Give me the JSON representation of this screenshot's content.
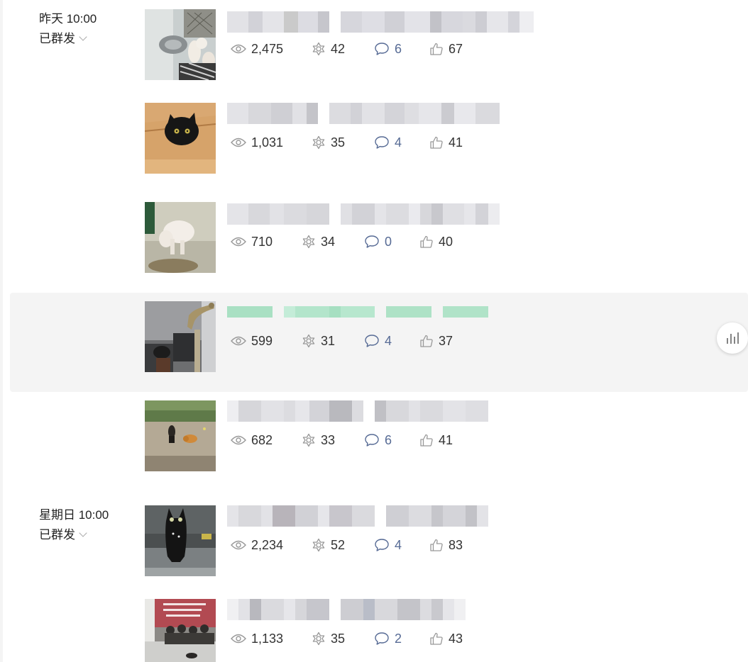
{
  "groups": [
    {
      "date": "昨天 10:00",
      "status": "已群发",
      "articles": [
        {
          "views": "2,475",
          "shares": "42",
          "comments": "6",
          "likes": "67"
        },
        {
          "views": "1,031",
          "shares": "35",
          "comments": "4",
          "likes": "41"
        },
        {
          "views": "710",
          "shares": "34",
          "comments": "0",
          "likes": "40"
        },
        {
          "views": "599",
          "shares": "31",
          "comments": "4",
          "likes": "37"
        },
        {
          "views": "682",
          "shares": "33",
          "comments": "6",
          "likes": "41"
        }
      ]
    },
    {
      "date": "星期日 10:00",
      "status": "已群发",
      "articles": [
        {
          "views": "2,234",
          "shares": "52",
          "comments": "4",
          "likes": "83"
        },
        {
          "views": "1,133",
          "shares": "35",
          "comments": "2",
          "likes": "43"
        }
      ]
    }
  ],
  "icons": {
    "views": "eye-icon",
    "shares": "share-icon",
    "comments": "comment-icon",
    "likes": "thumbs-up-icon",
    "status_toggle": "chevron-down-icon",
    "stats_button": "bar-chart-icon"
  },
  "colors": {
    "comment_count": "#576b95",
    "highlight_row": "#f4f4f4",
    "highlight_title": "#a8e2c4",
    "blurred_title": "#d6d6d9"
  }
}
